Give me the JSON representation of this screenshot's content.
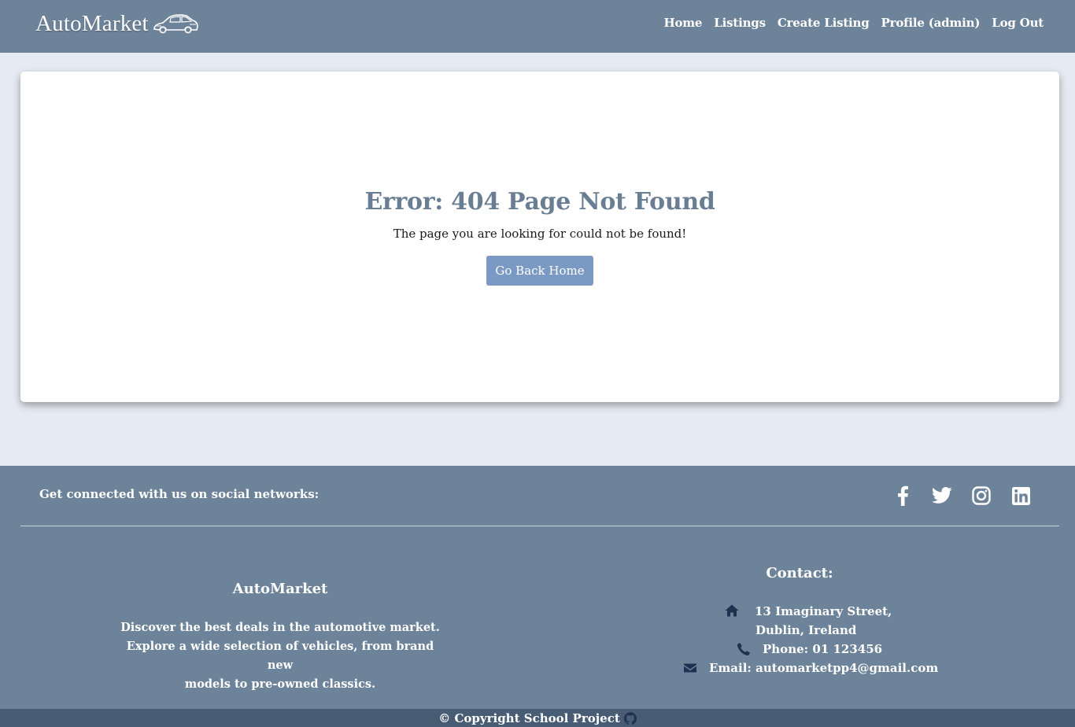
{
  "nav": {
    "brand": "AutoMarket",
    "links": [
      "Home",
      "Listings",
      "Create Listing",
      "Profile (admin)",
      "Log Out"
    ]
  },
  "error": {
    "title": "Error: 404 Page Not Found",
    "message": "The page you are looking for could not be found!",
    "button": "Go Back Home"
  },
  "footer": {
    "social_text": "Get connected with us on social networks:",
    "social_icons": [
      "facebook-icon",
      "twitter-icon",
      "instagram-icon",
      "linkedin-icon"
    ],
    "about_title": "AutoMarket",
    "about_lines": [
      "Discover the best deals in the automotive market.",
      "Explore a wide selection of vehicles, from brand new",
      "models to pre-owned classics."
    ],
    "contact_title": "Contact:",
    "address_line1": "13 Imaginary Street,",
    "address_line2": "Dublin, Ireland",
    "phone": "Phone: 01 123456",
    "email": "Email: automarketpp4@gmail.com",
    "copyright": "© Copyright School Project"
  },
  "colors": {
    "navbar": "#6d8399",
    "page_bg": "#e6eaf2",
    "button": "#7a9ac4",
    "copyright_bar": "#485c74",
    "contact_icons": "#1f3151"
  }
}
